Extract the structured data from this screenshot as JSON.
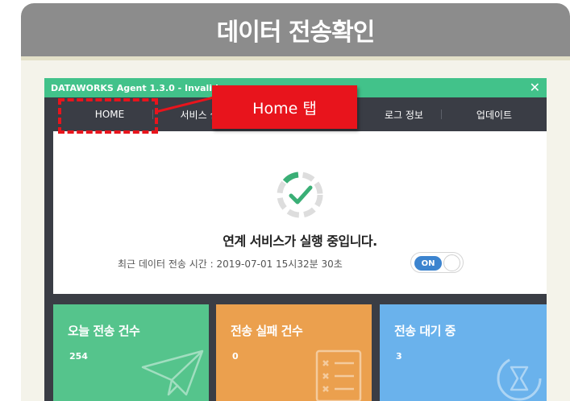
{
  "header": {
    "title": "데이터 전송확인"
  },
  "app": {
    "title": "DATAWORKS Agent 1.3.0 - Invalid",
    "close_glyph": "✕",
    "tabs": [
      {
        "label": "HOME",
        "active": true
      },
      {
        "label": "서비스 설정",
        "active": false
      },
      {
        "label": "",
        "active": false
      },
      {
        "label": "로그 정보",
        "active": false
      },
      {
        "label": "업데이트",
        "active": false
      }
    ]
  },
  "status": {
    "icon": "check-spinner-icon",
    "message": "연계 서비스가 실행 중입니다.",
    "last_transfer": "최근 데이터 전송 시간 : 2019-07-01 15시32분 30초",
    "toggle_label": "ON",
    "toggle_on": true
  },
  "tiles": [
    {
      "title": "오늘 전송 건수",
      "count": "254",
      "color": "#55c48c",
      "icon": "paper-plane-icon"
    },
    {
      "title": "전송 실패 건수",
      "count": "0",
      "color": "#eba04e",
      "icon": "checklist-icon"
    },
    {
      "title": "전송 대기 중",
      "count": "3",
      "color": "#6ab2ec",
      "icon": "hourglass-icon"
    }
  ],
  "annotation": {
    "label": "Home 탭"
  },
  "colors": {
    "accent_green": "#42c28a",
    "highlight_red": "#e8141c",
    "toggle_blue": "#3c84cf"
  }
}
